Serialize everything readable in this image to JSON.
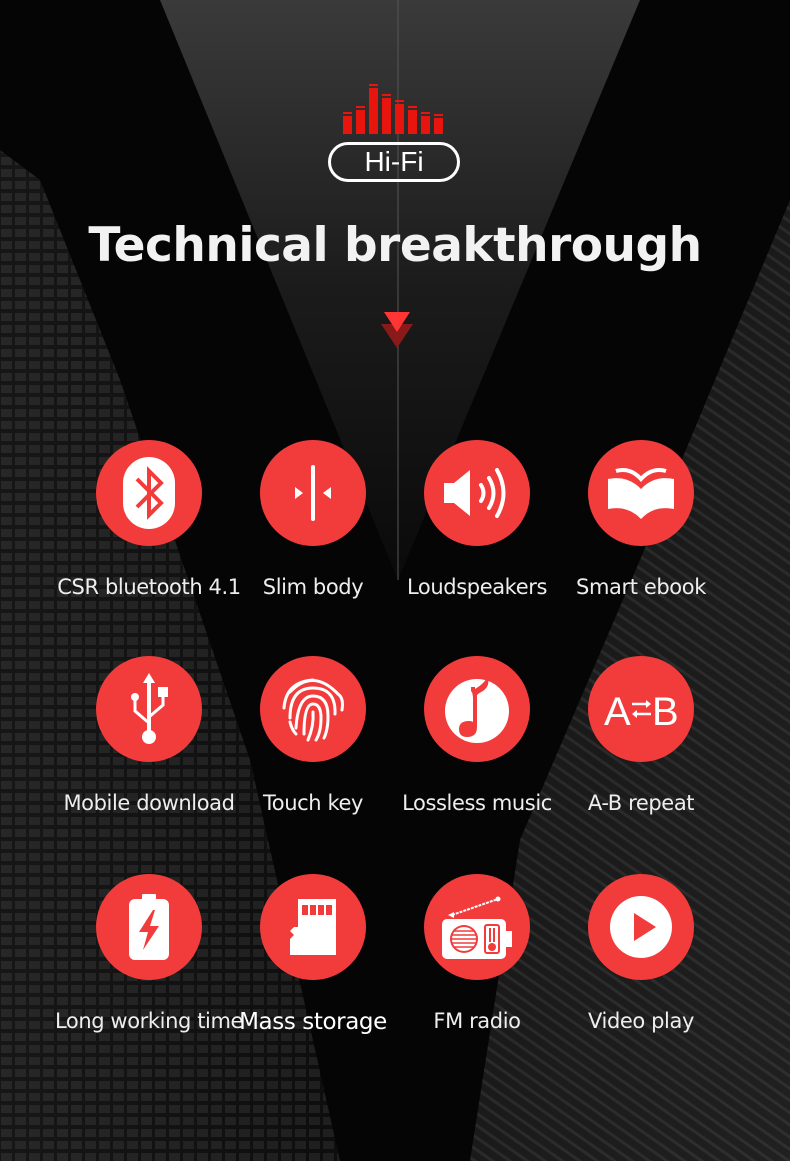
{
  "header": {
    "badge_text": "Hi-Fi",
    "title": "Technical breakthrough"
  },
  "colors": {
    "accent": "#f23c3c",
    "background": "#050505",
    "text": "#eeeeee"
  },
  "features": [
    {
      "label": "CSR bluetooth 4.1",
      "icon": "bluetooth-icon"
    },
    {
      "label": "Slim body",
      "icon": "slim-body-icon"
    },
    {
      "label": "Loudspeakers",
      "icon": "speaker-icon"
    },
    {
      "label": "Smart ebook",
      "icon": "book-icon"
    },
    {
      "label": "Mobile download",
      "icon": "usb-icon"
    },
    {
      "label": "Touch key",
      "icon": "fingerprint-icon"
    },
    {
      "label": "Lossless music",
      "icon": "music-note-icon"
    },
    {
      "label": "A-B repeat",
      "icon": "ab-repeat-icon"
    },
    {
      "label": "Long working time",
      "icon": "battery-charging-icon"
    },
    {
      "label": "Mass storage",
      "icon": "sd-card-icon"
    },
    {
      "label": "FM radio",
      "icon": "radio-icon"
    },
    {
      "label": "Video play",
      "icon": "play-icon"
    }
  ],
  "ab_icon_text": {
    "a": "A",
    "b": "B"
  }
}
